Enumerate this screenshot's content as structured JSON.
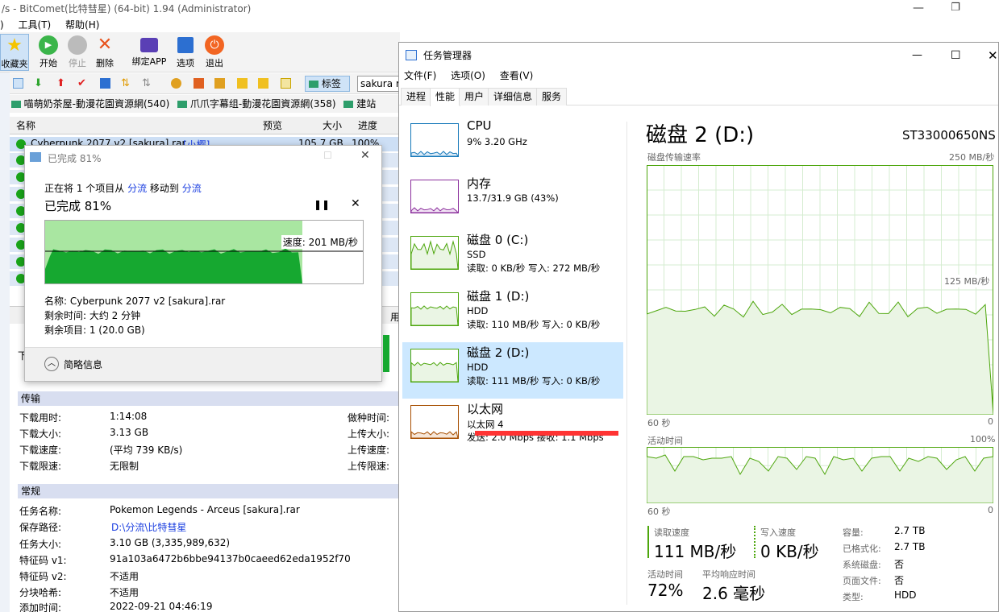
{
  "bitcomet": {
    "title": "/s - BitComet(比特彗星) (64-bit) 1.94 (Administrator)",
    "menu": [
      ")",
      "工具(T)",
      "帮助(H)"
    ],
    "toolbar": [
      {
        "label": "收藏夹",
        "icon": "star-icon"
      },
      {
        "label": "开始",
        "icon": "play-icon"
      },
      {
        "label": "停止",
        "icon": "stop-icon"
      },
      {
        "label": "删除",
        "icon": "delete-icon"
      },
      {
        "label": "绑定APP",
        "icon": "bind-app-icon"
      },
      {
        "label": "选项",
        "icon": "options-icon"
      },
      {
        "label": "退出",
        "icon": "power-icon"
      }
    ],
    "tag_button": "标签",
    "search_value": "sakura r",
    "tags": [
      "喵萌奶茶屋-動漫花園資源網(540)",
      "爪爪字幕组-動漫花園資源網(358)",
      "建站"
    ],
    "columns": {
      "name": "名称",
      "preview": "预览",
      "size": "大小",
      "progress": "进度"
    },
    "first_row": {
      "name": "Cyberpunk 2077 v2 [sakura].rar",
      "extra": "[小樱]",
      "size": "105.7 GB",
      "progress": "100%"
    },
    "partial_tab": "用",
    "partial_label": "下",
    "transfer": {
      "header": "传输",
      "items": [
        {
          "k": "下载用时:",
          "v": "1:14:08",
          "k2": "做种时间:"
        },
        {
          "k": "下载大小:",
          "v": "3.13 GB",
          "k2": "上传大小:"
        },
        {
          "k": "下载速度:",
          "v": "(平均 739 KB/s)",
          "k2": "上传速度:"
        },
        {
          "k": "下载限速:",
          "v": "无限制",
          "k2": "上传限速:"
        }
      ]
    },
    "general": {
      "header": "常规",
      "items": [
        {
          "k": "任务名称:",
          "v": "Pokemon Legends - Arceus [sakura].rar"
        },
        {
          "k": "保存路径:",
          "v": "D:\\分流\\比特彗星"
        },
        {
          "k": "任务大小:",
          "v": "3.10 GB (3,335,989,632)"
        },
        {
          "k": "特征码 v1:",
          "v": "91a103a6472b6bbe94137b0caeed62eda1952f70"
        },
        {
          "k": "特征码 v2:",
          "v": "不适用"
        },
        {
          "k": "分块哈希:",
          "v": "不适用"
        },
        {
          "k": "添加时间:",
          "v": "2022-09-21 04:46:19"
        }
      ]
    }
  },
  "dialog": {
    "title": "已完成 81%",
    "line1_a": "正在将 1 个项目从 ",
    "line1_src": "分流",
    "line1_b": " 移动到 ",
    "line1_dst": "分流",
    "percent_title": "已完成 81%",
    "speed": "速度: 201 MB/秒",
    "progress": 0.81,
    "name": "名称: Cyberpunk 2077 v2 [sakura].rar",
    "remaining_time": "剩余时间: 大约 2 分钟",
    "remaining_items": "剩余项目: 1 (20.0 GB)",
    "less_info": "简略信息"
  },
  "taskmgr": {
    "title": "任务管理器",
    "menu": [
      "文件(F)",
      "选项(O)",
      "查看(V)"
    ],
    "tabs": [
      "进程",
      "性能",
      "用户",
      "详细信息",
      "服务"
    ],
    "devices": [
      {
        "name": "CPU",
        "s1": "9% 3.20 GHz",
        "s2": "",
        "color": "#1779ba"
      },
      {
        "name": "内存",
        "s1": "13.7/31.9 GB (43%)",
        "s2": "",
        "color": "#8b2f9c"
      },
      {
        "name": "磁盘 0 (C:)",
        "s1": "SSD",
        "s2": "读取: 0 KB/秒 写入: 272 MB/秒",
        "color": "#4da60c"
      },
      {
        "name": "磁盘 1 (D:)",
        "s1": "HDD",
        "s2": "读取: 110 MB/秒 写入: 0 KB/秒",
        "color": "#4da60c"
      },
      {
        "name": "磁盘 2 (D:)",
        "s1": "HDD",
        "s2": "读取: 111 MB/秒 写入: 0 KB/秒",
        "color": "#4da60c"
      },
      {
        "name": "以太网",
        "s1": "以太网 4",
        "s2": "发送: 2.0 Mbps 接收: 1.1 Mbps",
        "color": "#a74f01"
      }
    ],
    "selected_index": 4,
    "disk_title": "磁盘 2 (D:)",
    "model": "ST33000650NS",
    "graph1": {
      "label": "磁盘传输速率",
      "max": "250 MB/秒",
      "mid": "125 MB/秒",
      "time": "60 秒",
      "zero": "0"
    },
    "graph2": {
      "label": "活动时间",
      "max": "100%",
      "time": "60 秒",
      "zero": "0"
    },
    "stats": {
      "read_label": "读取速度",
      "read": "111 MB/秒",
      "write_label": "写入速度",
      "write": "0 KB/秒",
      "active_label": "活动时间",
      "active": "72%",
      "resp_label": "平均响应时间",
      "resp": "2.6 毫秒"
    },
    "props": [
      {
        "k": "容量:",
        "v": "2.7 TB"
      },
      {
        "k": "已格式化:",
        "v": "2.7 TB"
      },
      {
        "k": "系统磁盘:",
        "v": "否"
      },
      {
        "k": "页面文件:",
        "v": "否"
      },
      {
        "k": "类型:",
        "v": "HDD"
      }
    ]
  }
}
